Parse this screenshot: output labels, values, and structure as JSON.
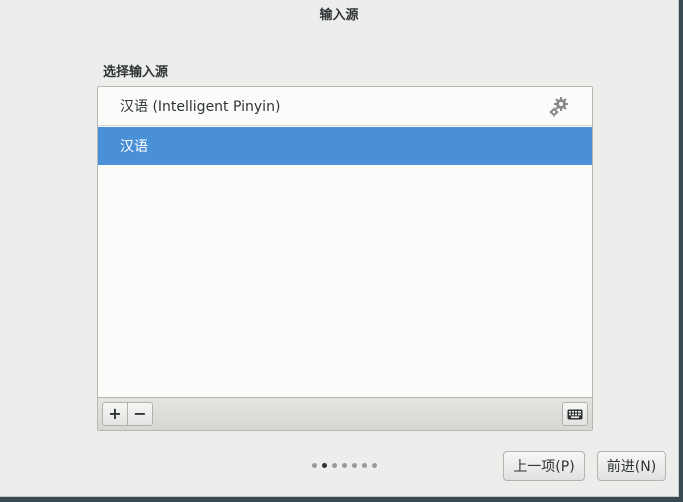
{
  "window": {
    "title": "输入源"
  },
  "section": {
    "label": "选择输入源"
  },
  "input_sources": [
    {
      "label": "汉语 (Intelligent Pinyin)",
      "has_settings": true,
      "selected": false
    },
    {
      "label": "汉语",
      "has_settings": false,
      "selected": true
    }
  ],
  "toolbar": {
    "add_label": "+",
    "remove_label": "−",
    "keyboard_icon": "keyboard-icon"
  },
  "pager": {
    "total": 7,
    "current": 2
  },
  "buttons": {
    "prev_label": "上一项(P)",
    "next_label": "前进(N)"
  },
  "colors": {
    "selection": "#4a90d9",
    "window_bg": "#ededec",
    "list_bg": "#fbfbfa"
  }
}
